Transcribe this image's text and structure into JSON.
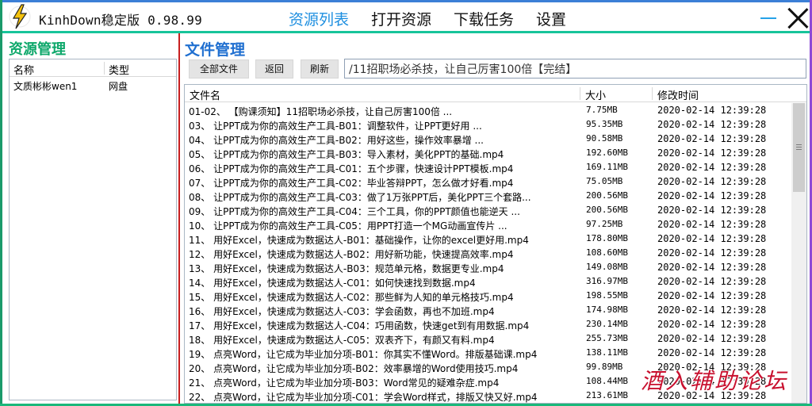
{
  "app": {
    "title": "KinhDown稳定版 0.98.99"
  },
  "nav": {
    "items": [
      {
        "label": "资源列表",
        "active": true
      },
      {
        "label": "打开资源",
        "active": false
      },
      {
        "label": "下载任务",
        "active": false
      },
      {
        "label": "设置",
        "active": false
      }
    ]
  },
  "left": {
    "title": "资源管理",
    "columns": [
      "名称",
      "类型"
    ],
    "rows": [
      {
        "name": "文质彬彬wen1",
        "type": "网盘"
      }
    ]
  },
  "right": {
    "title": "文件管理",
    "buttons": {
      "all": "全部文件",
      "back": "返回",
      "refresh": "刷新"
    },
    "path": "/11招职场必杀技，让自己厉害100倍【完结】",
    "columns": {
      "name": "文件名",
      "size": "大小",
      "time": "修改时间"
    },
    "files": [
      {
        "name": "01-02、 【购课须知】11招职场必杀技，让自己厉害100倍        ...",
        "size": "7.75MB",
        "time": "2020-02-14 12:39:28"
      },
      {
        "name": "03、 让PPT成为你的高效生产工具-B01：调整软件，让PPT更好用       ...",
        "size": "95.35MB",
        "time": "2020-02-14 12:39:28"
      },
      {
        "name": "04、 让PPT成为你的高效生产工具-B02：用好这些，操作效率暴增       ...",
        "size": "90.58MB",
        "time": "2020-02-14 12:39:28"
      },
      {
        "name": "05、 让PPT成为你的高效生产工具-B03：导入素材，美化PPT的基础.mp4",
        "size": "192.60MB",
        "time": "2020-02-14 12:39:28"
      },
      {
        "name": "06、 让PPT成为你的高效生产工具-C01：五个步骤，快速设计PPT模板.mp4",
        "size": "169.11MB",
        "time": "2020-02-14 12:39:28"
      },
      {
        "name": "07、 让PPT成为你的高效生产工具-C02：毕业答辩PPT，怎么做才好看.mp4",
        "size": "75.05MB",
        "time": "2020-02-14 12:39:28"
      },
      {
        "name": "08、 让PPT成为你的高效生产工具-C03：做了1万张PPT后，美化PPT三个套路...",
        "size": "200.56MB",
        "time": "2020-02-14 12:39:28"
      },
      {
        "name": "09、 让PPT成为你的高效生产工具-C04：三个工具，你的PPT颜值也能逆天  ...",
        "size": "200.56MB",
        "time": "2020-02-14 12:39:28"
      },
      {
        "name": "10、 让PPT成为你的高效生产工具-C05：用PPT打造一个MG动画宣传片     ...",
        "size": "97.25MB",
        "time": "2020-02-14 12:39:28"
      },
      {
        "name": "11、 用好Excel，快速成为数据达人-B01：基础操作，让你的excel更好用.mp4",
        "size": "178.80MB",
        "time": "2020-02-14 12:39:28"
      },
      {
        "name": "12、 用好Excel，快速成为数据达人-B02：用好新功能，快速提高效率.mp4",
        "size": "108.60MB",
        "time": "2020-02-14 12:39:28"
      },
      {
        "name": "13、 用好Excel，快速成为数据达人-B03：规范单元格，数据更专业.mp4",
        "size": "149.08MB",
        "time": "2020-02-14 12:39:28"
      },
      {
        "name": "14、 用好Excel，快速成为数据达人-C01：如何快速找到数据.mp4",
        "size": "316.97MB",
        "time": "2020-02-14 12:39:28"
      },
      {
        "name": "15、 用好Excel，快速成为数据达人-C02：那些鲜为人知的单元格技巧.mp4",
        "size": "198.55MB",
        "time": "2020-02-14 12:39:28"
      },
      {
        "name": "16、 用好Excel，快速成为数据达人-C03：学会函数，再也不加班.mp4",
        "size": "174.98MB",
        "time": "2020-02-14 12:39:28"
      },
      {
        "name": "17、 用好Excel，快速成为数据达人-C04：巧用函数，快速get到有用数据.mp4",
        "size": "230.14MB",
        "time": "2020-02-14 12:39:28"
      },
      {
        "name": "18、 用好Excel，快速成为数据达人-C05：双表齐下，有颜又有料.mp4",
        "size": "255.73MB",
        "time": "2020-02-14 12:39:28"
      },
      {
        "name": "19、 点亮Word，让它成为毕业加分项-B01：你其实不懂Word。排版基础课.mp4",
        "size": "138.11MB",
        "time": "2020-02-14 12:39:28"
      },
      {
        "name": "20、 点亮Word，让它成为毕业加分项-B02：效率暴增的Word使用技巧.mp4",
        "size": "99.89MB",
        "time": "2020-02-14 12:39:28"
      },
      {
        "name": "21、 点亮Word，让它成为毕业加分项-B03：Word常见的疑难杂症.mp4",
        "size": "108.44MB",
        "time": "2020-02-14 12:39:28"
      },
      {
        "name": "22、 点亮Word，让它成为毕业加分项-C01：学会Word样式，排版又快又好.mp4",
        "size": "213.61MB",
        "time": "2020-02-14 12:39:28"
      }
    ]
  },
  "watermark": "酒入辅助论坛",
  "colors": {
    "accent_blue": "#1e8fe0",
    "left_title_green": "#0ea86b",
    "right_title_blue": "#1f6fd0",
    "separator_red": "#c71f1f",
    "watermark_red": "#c8102e"
  }
}
